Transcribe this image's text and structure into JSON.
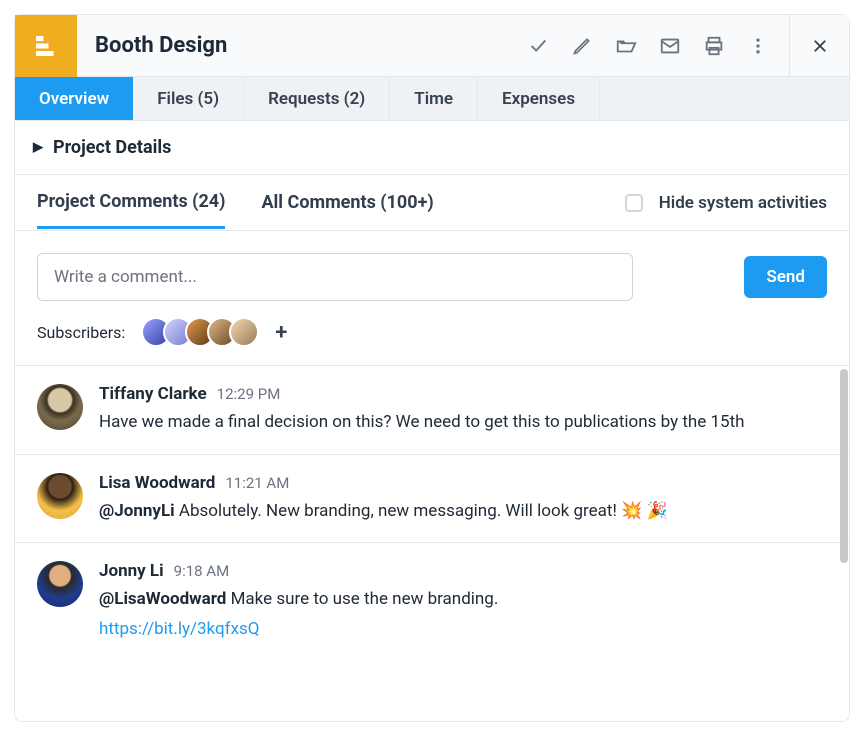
{
  "header": {
    "title": "Booth Design"
  },
  "tabs": {
    "overview": "Overview",
    "files": "Files (5)",
    "requests": "Requests (2)",
    "time": "Time",
    "expenses": "Expenses"
  },
  "sections": {
    "project_details": "Project Details"
  },
  "commentTabs": {
    "project": "Project Comments (24)",
    "all": "All Comments (100+)",
    "hide_system": "Hide system activities"
  },
  "compose": {
    "placeholder": "Write a comment...",
    "send": "Send"
  },
  "subscribers": {
    "label": "Subscribers:"
  },
  "comments": [
    {
      "author": "Tiffany Clarke",
      "time": "12:29 PM",
      "text": "Have we made a final decision on this? We need to get this to publications by the 15th"
    },
    {
      "author": "Lisa Woodward",
      "time": "11:21 AM",
      "mention": "@JonnyLi",
      "text": " Absolutely. New branding, new messaging. Will look great! 💥 🎉"
    },
    {
      "author": "Jonny Li",
      "time": "9:18 AM",
      "mention": "@LisaWoodward",
      "text": " Make sure to use the new branding.",
      "link": "https://bit.ly/3kqfxsQ"
    }
  ]
}
